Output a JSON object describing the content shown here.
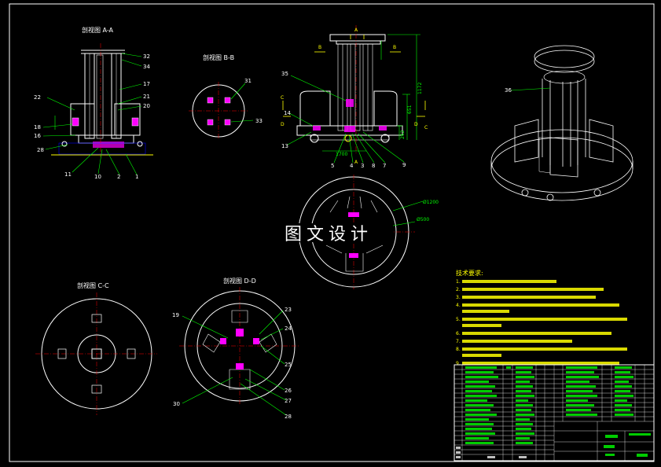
{
  "views": {
    "section_aa": "剖视图 A-A",
    "section_bb": "剖视图 B-B",
    "section_cc": "剖视图 C-C",
    "section_dd": "剖视图 D-D"
  },
  "part_labels_aa": [
    "32",
    "34",
    "17",
    "21",
    "20",
    "22",
    "18",
    "16",
    "28",
    "11",
    "10",
    "2",
    "1"
  ],
  "part_labels_bb": [
    "31",
    "33"
  ],
  "part_labels_front": [
    "35",
    "14",
    "13",
    "5",
    "4",
    "3",
    "8",
    "7",
    "9"
  ],
  "part_labels_iso": [
    "36"
  ],
  "part_labels_dd": [
    "19",
    "23",
    "24",
    "25",
    "26",
    "27",
    "28",
    "30"
  ],
  "dims_front": [
    "1172",
    "651",
    "262",
    "1700"
  ],
  "dims_round": [
    "Ø1200",
    "Ø500"
  ],
  "section_marks": [
    "A",
    "A",
    "B",
    "B",
    "C",
    "C",
    "D",
    "D"
  ],
  "watermark": "图文设计",
  "tech_req": {
    "title": "技术要求:",
    "items": [
      "1.",
      "2.",
      "3.",
      "4.",
      "5.",
      "6.",
      "7.",
      "8.",
      "9."
    ]
  },
  "colors": {
    "background": "#000000",
    "line": "#ffffff",
    "dimension": "#00ff00",
    "label": "#ffffff",
    "hidden": "#ff00ff",
    "note": "#ffff00"
  }
}
